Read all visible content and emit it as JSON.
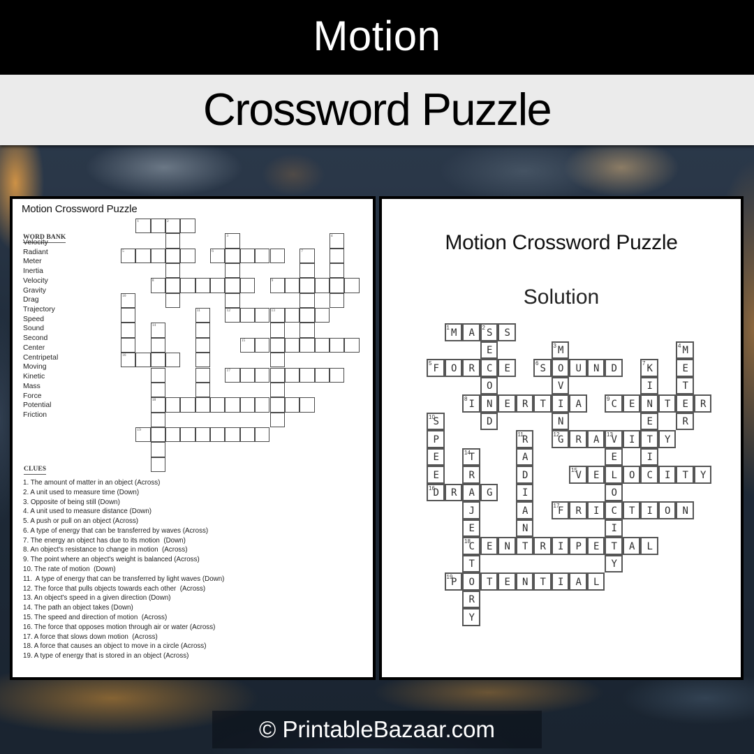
{
  "banner": {
    "title": "Motion",
    "subtitle": "Crossword Puzzle"
  },
  "puzzle_page": {
    "title": "Motion Crossword Puzzle",
    "word_bank_heading": "WORD BANK",
    "word_bank": [
      "Velocity",
      "Radiant",
      "Meter",
      "Inertia",
      "Velocity",
      "Gravity",
      "Drag",
      "Trajectory",
      "Speed",
      "Sound",
      "Second",
      "Center",
      "Centripetal",
      "Moving",
      "Kinetic",
      "Mass",
      "Force",
      "Potential",
      "Friction"
    ],
    "clues_heading": "CLUES",
    "clues": [
      "1. The amount of matter in an object (Across)",
      "2. A unit used to measure time (Down)",
      "3. Opposite of being still (Down)",
      "4. A unit used to measure distance (Down)",
      "5. A push or pull on an object (Across)",
      "6. A type of energy that can be transferred by waves (Across)",
      "7. The energy an object has due to its motion  (Down)",
      "8. An object's resistance to change in motion  (Across)",
      "9. The point where an object's weight is balanced (Across)",
      "10. The rate of motion  (Down)",
      "11.  A type of energy that can be transferred by light waves (Down)",
      "12. The force that pulls objects towards each other  (Across)",
      "13. An object's speed in a given direction (Down)",
      "14. The path an object takes (Down)",
      "15. The speed and direction of motion  (Across)",
      "16. The force that opposes motion through air or water (Across)",
      "17. A force that slows down motion  (Across)",
      "18. A force that causes an object to move in a circle (Across)",
      "19. A type of energy that is stored in an object (Across)"
    ]
  },
  "solution_page": {
    "title": "Motion Crossword Puzzle",
    "subtitle": "Solution"
  },
  "crossword": {
    "blank_char": ".",
    "solution_rows": [
      ".MASS...........",
      "...E...M......M.",
      "FORCE.SOUND.K.E.",
      "...O...V....I.T.",
      "..INERTIA.CENTER",
      "S..D...N....E.R.",
      "P....R.GRAVITY..",
      "E.T..A....E.I...",
      "E.R..D..VELOCITY",
      "DRAG.I....O.....",
      "..J..A.FRICTION.",
      "..E..N....I.....",
      "..CENTRIPETAL...",
      "..T.......Y.....",
      ".POTENTIAL......",
      "..R.............",
      "..Y............."
    ]
  },
  "footer": {
    "copyright": "© PrintableBazaar.com"
  },
  "colors": {
    "banner_top": "#000000",
    "banner_sub": "#ebebeb",
    "page_border": "#000000",
    "cell_border": "#4a4a4a",
    "text_dark": "#1e1e1e"
  }
}
